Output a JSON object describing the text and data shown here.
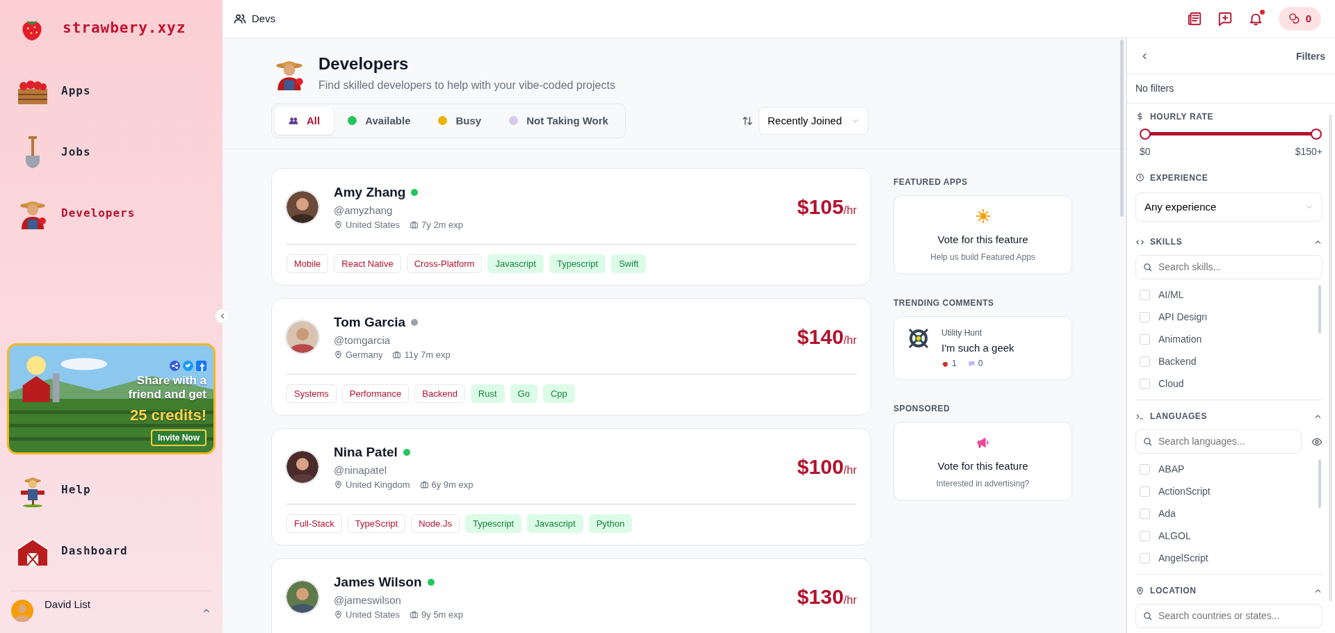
{
  "sidebar": {
    "logo": "strawbery.xyz",
    "nav": [
      {
        "label": "Apps",
        "selected": false
      },
      {
        "label": "Jobs",
        "selected": false
      },
      {
        "label": "Developers",
        "selected": true
      }
    ],
    "promo": {
      "text": "Share with a friend and get",
      "highlight": "25 credits!",
      "button": "Invite Now"
    },
    "bottom_nav": [
      {
        "label": "Help"
      },
      {
        "label": "Dashboard"
      }
    ],
    "user": {
      "name": "David List"
    }
  },
  "topbar": {
    "breadcrumb": "Devs",
    "notification": true,
    "credits": "0"
  },
  "page": {
    "title": "Developers",
    "subtitle": "Find skilled developers to help with your vibe-coded projects"
  },
  "status_tabs": [
    {
      "label": "All",
      "kind": "all",
      "selected": true
    },
    {
      "label": "Available",
      "kind": "status",
      "color": "#22c55e",
      "selected": false
    },
    {
      "label": "Busy",
      "kind": "status",
      "color": "#eab308",
      "selected": false
    },
    {
      "label": "Not Taking Work",
      "kind": "status",
      "color": "#d8c8ee",
      "selected": false
    }
  ],
  "sort": {
    "value": "Recently Joined"
  },
  "developers": [
    {
      "name": "Amy Zhang",
      "color": "#22c55e",
      "handle": "@amyzhang",
      "location": "United States",
      "experience": "7y 2m exp",
      "rate": "$105",
      "unit": "/hr",
      "tags": [
        {
          "label": "Mobile",
          "kind": "category"
        },
        {
          "label": "React Native",
          "kind": "category"
        },
        {
          "label": "Cross-Platform",
          "kind": "category"
        },
        {
          "label": "Javascript",
          "kind": "language"
        },
        {
          "label": "Typescript",
          "kind": "language"
        },
        {
          "label": "Swift",
          "kind": "language"
        }
      ]
    },
    {
      "name": "Tom Garcia",
      "color": "#9ca3af",
      "handle": "@tomgarcia",
      "location": "Germany",
      "experience": "11y 7m exp",
      "rate": "$140",
      "unit": "/hr",
      "tags": [
        {
          "label": "Systems",
          "kind": "category"
        },
        {
          "label": "Performance",
          "kind": "category"
        },
        {
          "label": "Backend",
          "kind": "category"
        },
        {
          "label": "Rust",
          "kind": "language"
        },
        {
          "label": "Go",
          "kind": "language"
        },
        {
          "label": "Cpp",
          "kind": "language"
        }
      ]
    },
    {
      "name": "Nina Patel",
      "color": "#22c55e",
      "handle": "@ninapatel",
      "location": "United Kingdom",
      "experience": "6y 9m exp",
      "rate": "$100",
      "unit": "/hr",
      "tags": [
        {
          "label": "Full-Stack",
          "kind": "category"
        },
        {
          "label": "TypeScript",
          "kind": "category"
        },
        {
          "label": "Node.Js",
          "kind": "category"
        },
        {
          "label": "Typescript",
          "kind": "language"
        },
        {
          "label": "Javascript",
          "kind": "language"
        },
        {
          "label": "Python",
          "kind": "language"
        }
      ]
    },
    {
      "name": "James Wilson",
      "color": "#22c55e",
      "handle": "@jameswilson",
      "location": "United States",
      "experience": "9y 5m exp",
      "rate": "$130",
      "unit": "/hr"
    }
  ],
  "aside": [
    {
      "heading": "FEATURED APPS",
      "kind": "featured",
      "title": "Vote for this feature",
      "text": "Help us build Featured Apps"
    },
    {
      "heading": "TRENDING COMMENTS",
      "kind": "comment",
      "author": "Utility Hunt",
      "text": "I'm such a geek",
      "likes": "1",
      "replies": "0"
    },
    {
      "heading": "SPONSORED",
      "kind": "sponsored",
      "title": "Vote for this feature",
      "text": "Interested in advertising?"
    }
  ],
  "filters": {
    "title": "Filters",
    "summary": "No filters",
    "hourly_rate": {
      "label": "HOURLY RATE",
      "thumbs": [
        {
          "level": 0
        },
        {
          "level": 1
        }
      ],
      "min_label": "$0",
      "max_label": "$150+"
    },
    "experience": {
      "label": "EXPERIENCE",
      "value": "Any experience"
    },
    "skills": {
      "label": "SKILLS",
      "expanded": true,
      "placeholder": "Search skills...",
      "options": [
        {
          "label": "AI/ML",
          "checked": false
        },
        {
          "label": "API Design",
          "checked": false
        },
        {
          "label": "Animation",
          "checked": false
        },
        {
          "label": "Backend",
          "checked": false
        },
        {
          "label": "Cloud",
          "checked": false
        }
      ]
    },
    "languages": {
      "label": "LANGUAGES",
      "expanded": true,
      "placeholder": "Search languages...",
      "options": [
        {
          "label": "ABAP",
          "checked": false
        },
        {
          "label": "ActionScript",
          "checked": false
        },
        {
          "label": "Ada",
          "checked": false
        },
        {
          "label": "ALGOL",
          "checked": false
        },
        {
          "label": "AngelScript",
          "checked": false
        }
      ]
    },
    "location": {
      "label": "LOCATION",
      "expanded": true,
      "placeholder": "Search countries or states..."
    }
  }
}
